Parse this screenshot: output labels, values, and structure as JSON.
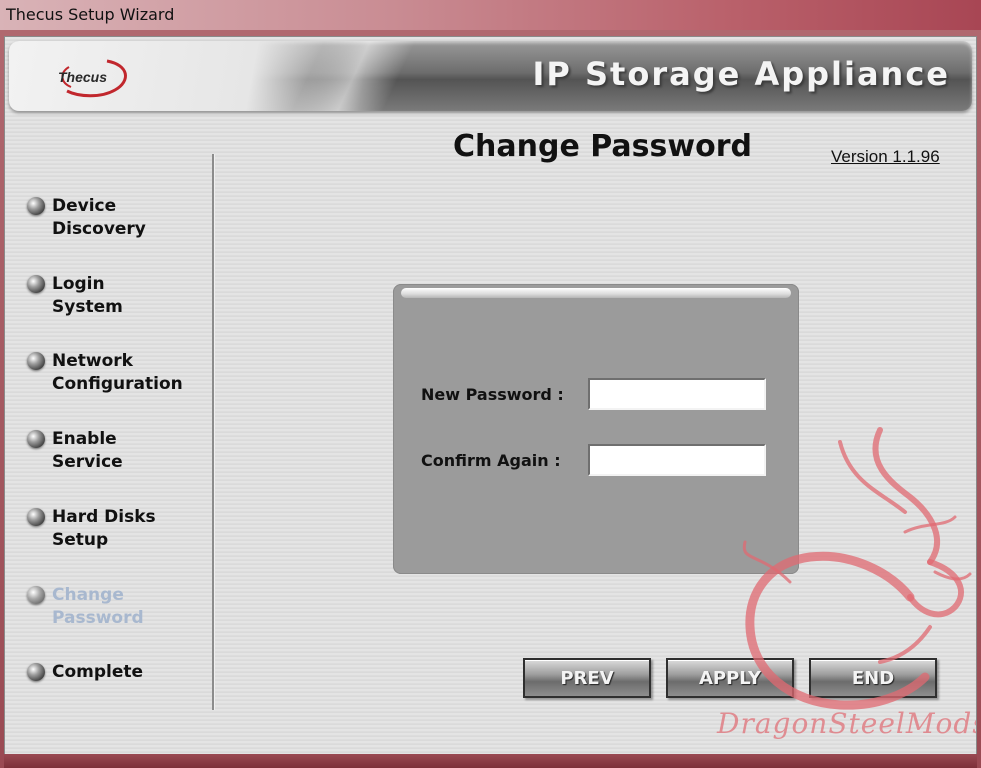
{
  "window": {
    "title": "Thecus Setup Wizard"
  },
  "header": {
    "logo_text": "Thecus",
    "product_title": "IP Storage Appliance"
  },
  "sidebar": {
    "items": [
      {
        "line1": "Device",
        "line2": "Discovery"
      },
      {
        "line1": "Login",
        "line2": "System"
      },
      {
        "line1": "Network",
        "line2": "Configuration"
      },
      {
        "line1": "Enable",
        "line2": "Service"
      },
      {
        "line1": "Hard Disks",
        "line2": "Setup"
      },
      {
        "line1": "Change",
        "line2": "Password"
      },
      {
        "line1": "Complete",
        "line2": ""
      }
    ],
    "active_index": 5,
    "active_color": "#a8b8cf"
  },
  "main": {
    "title": "Change Password",
    "version": "Version 1.1.96",
    "form": {
      "new_password_label": "New Password :",
      "new_password_value": "",
      "confirm_label": "Confirm Again :",
      "confirm_value": ""
    }
  },
  "buttons": {
    "prev": "PREV",
    "apply": "APPLY",
    "end": "END"
  },
  "watermark": {
    "text": "DragonSteelMods",
    "color": "#e06a72"
  }
}
